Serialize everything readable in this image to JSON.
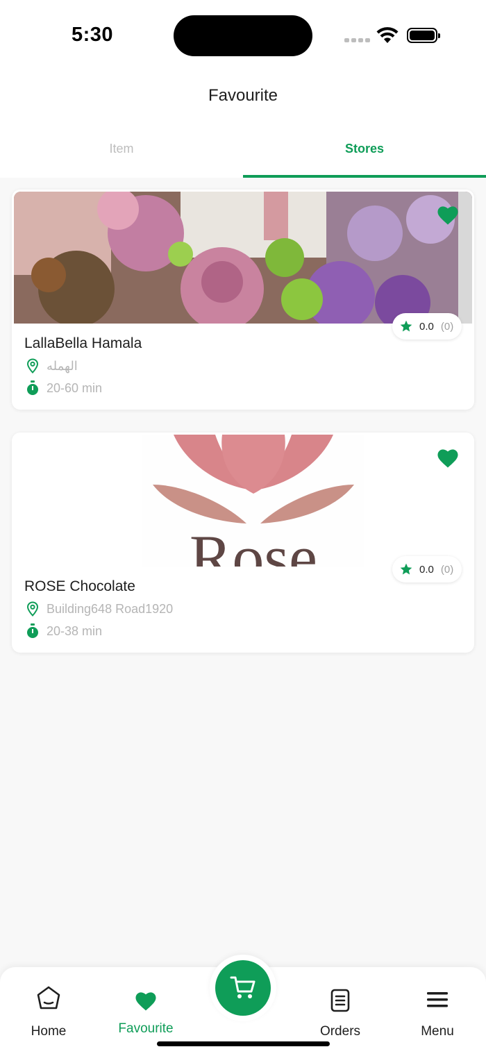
{
  "status": {
    "time": "5:30"
  },
  "header": {
    "title": "Favourite"
  },
  "tabs": [
    {
      "label": "Item",
      "active": false
    },
    {
      "label": "Stores",
      "active": true
    }
  ],
  "stores": [
    {
      "name": "LallaBella Hamala",
      "address": "الهمله",
      "delivery_time": "20-60 min",
      "rating": "0.0",
      "rating_count": "(0)",
      "favourited": true
    },
    {
      "name": "ROSE Chocolate",
      "address": "Building648 Road1920",
      "delivery_time": "20-38 min",
      "rating": "0.0",
      "rating_count": "(0)",
      "favourited": true,
      "logo_text": "Rose"
    }
  ],
  "bottom_nav": {
    "home": "Home",
    "favourite": "Favourite",
    "orders": "Orders",
    "menu": "Menu"
  },
  "colors": {
    "accent": "#0f9d58",
    "muted": "#b5b5b5",
    "rose": "#d8858a"
  },
  "icons": [
    "heart-icon",
    "star-icon",
    "location-pin-icon",
    "stopwatch-icon",
    "home-icon",
    "cart-icon",
    "orders-icon",
    "menu-icon"
  ]
}
